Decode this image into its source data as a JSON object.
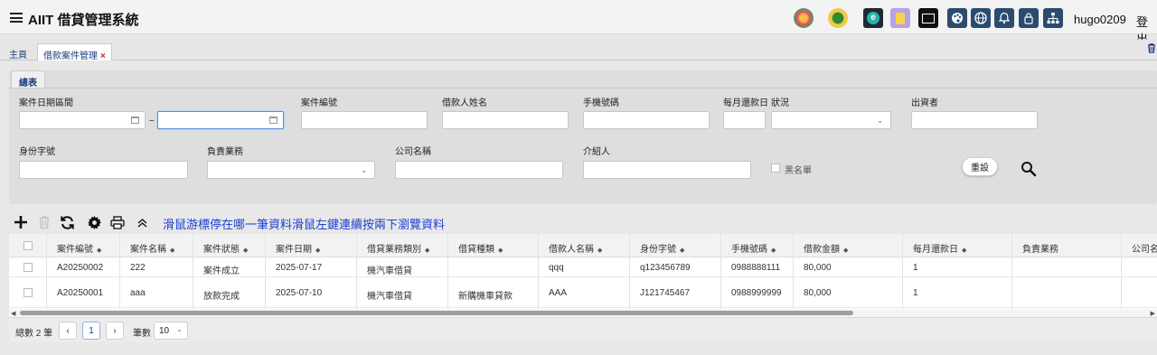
{
  "app": {
    "title": "AIIT 借貸管理系統",
    "username": "hugo0209",
    "logout_label": "登出"
  },
  "header_icons": [
    "flower-logo-icon",
    "sun-logo-icon",
    "e-app-icon",
    "notes-app-icon",
    "photo-app-icon",
    "palette-icon",
    "globe-icon",
    "bell-icon",
    "lock-icon",
    "sitemap-icon"
  ],
  "tabs": [
    {
      "label": "主頁",
      "closable": false
    },
    {
      "label": "借款案件管理",
      "closable": true,
      "close": "×"
    }
  ],
  "filter": {
    "section_tab": "總表",
    "date_range_label": "案件日期區間",
    "range_sep": "~",
    "case_no_label": "案件編號",
    "borrower_name_label": "借款人姓名",
    "phone_label": "手機號碼",
    "monthly_day_label": "每月還款日",
    "status_label": "狀況",
    "investor_label": "出資者",
    "id_no_label": "身份字號",
    "staff_label": "負責業務",
    "company_label": "公司名稱",
    "referrer_label": "介紹人",
    "blacklist_label": "黑名單",
    "reset_label": "重設"
  },
  "toolbar": {
    "hint": "滑鼠游標停在哪一筆資料滑鼠左鍵連續按兩下瀏覽資料"
  },
  "table": {
    "columns": [
      "案件編號",
      "案件名稱",
      "案件狀態",
      "案件日期",
      "借貸業務類別",
      "借貸種類",
      "借款人名稱",
      "身份字號",
      "手機號碼",
      "借款金額",
      "每月還款日",
      "負責業務",
      "公司名"
    ],
    "rows": [
      [
        "A20250002",
        "222",
        "案件成立",
        "2025-07-17",
        "機汽車借貸",
        "",
        "qqq",
        "q123456789",
        "0988888111",
        "80,000",
        "1",
        "",
        ""
      ],
      [
        "A20250001",
        "aaa",
        "放款完成",
        "2025-07-10",
        "機汽車借貸",
        "新購機車貸款",
        "AAA",
        "J121745467",
        "0988999999",
        "80,000",
        "1",
        "",
        ""
      ]
    ]
  },
  "pager": {
    "total_label": "總數 2 筆",
    "prev": "‹",
    "page": "1",
    "next": "›",
    "size_label": "筆數",
    "size_value": "10"
  },
  "colors": {
    "accent": "#1a3f80",
    "hint": "#1c3fd1",
    "close": "#d22233"
  }
}
